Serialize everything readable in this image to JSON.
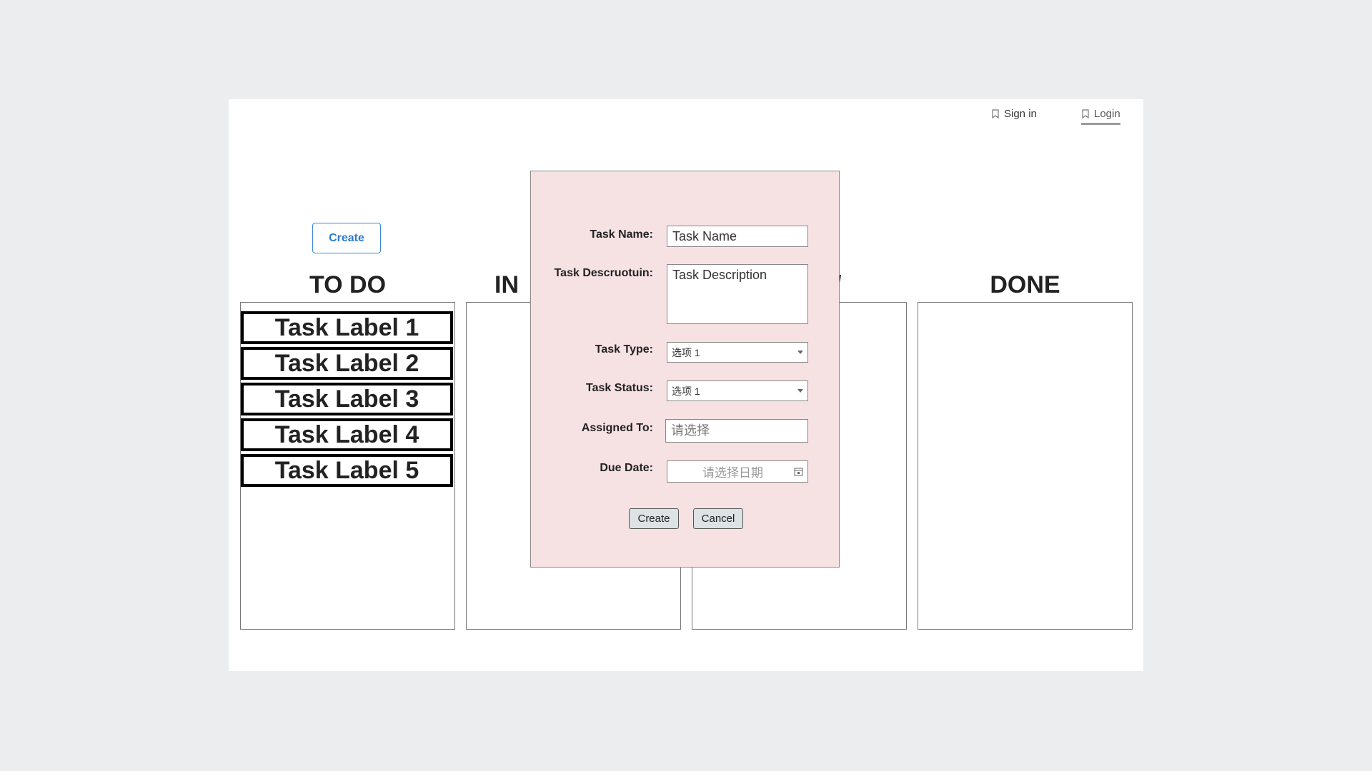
{
  "nav": {
    "signin_label": "Sign in",
    "login_label": "Login"
  },
  "main": {
    "create_label": "Create"
  },
  "columns": [
    {
      "title": "TO DO"
    },
    {
      "title": "IN"
    },
    {
      "title": "/"
    },
    {
      "title": "DONE"
    }
  ],
  "tasks": [
    {
      "label": "Task Label 1"
    },
    {
      "label": "Task Label 2"
    },
    {
      "label": "Task Label 3"
    },
    {
      "label": "Task Label 4"
    },
    {
      "label": "Task Label 5"
    }
  ],
  "modal": {
    "task_name_label": "Task Name:",
    "task_name_value": "Task Name",
    "task_desc_label": "Task Descruotuin:",
    "task_desc_value": "Task Description",
    "task_type_label": "Task Type:",
    "task_type_value": "选项 1",
    "task_status_label": "Task Status:",
    "task_status_value": "选项 1",
    "assigned_label": "Assigned To:",
    "assigned_placeholder": "请选择",
    "due_label": "Due Date:",
    "due_placeholder": "请选择日期",
    "create_label": "Create",
    "cancel_label": "Cancel"
  },
  "colors": {
    "background": "#ecedef",
    "modal_bg": "#f6e1e3",
    "accent": "#2b7bd0",
    "modal_button_bg": "#dde3e4"
  }
}
